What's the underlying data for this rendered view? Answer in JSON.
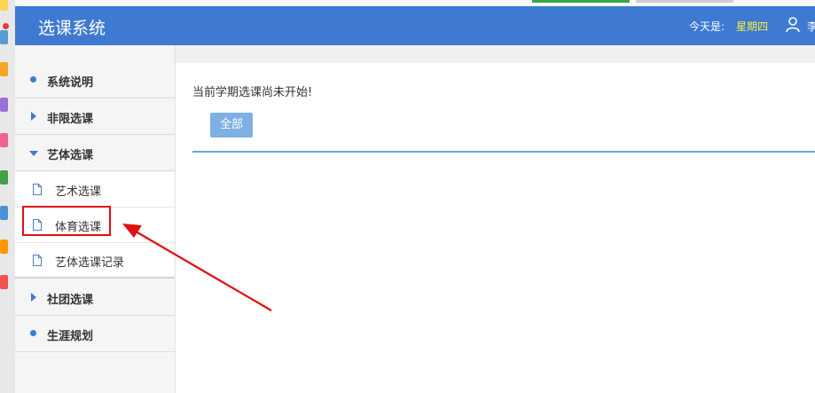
{
  "header": {
    "title": "选课系统",
    "today_label": "今天是:",
    "weekday": "星期四",
    "user_name": "李"
  },
  "sidebar": {
    "items": [
      {
        "label": "系统说明",
        "marker": "bullet"
      },
      {
        "label": "非限选课",
        "marker": "arrow-right"
      },
      {
        "label": "艺体选课",
        "marker": "arrow-down",
        "expanded": true
      },
      {
        "label": "社团选课",
        "marker": "arrow-right"
      },
      {
        "label": "生涯规划",
        "marker": "bullet"
      }
    ],
    "sub_items": [
      {
        "label": "艺术选课",
        "icon": "document-icon"
      },
      {
        "label": "体育选课",
        "icon": "document-icon",
        "highlighted": true
      },
      {
        "label": "艺体选课记录",
        "icon": "document-icon"
      }
    ]
  },
  "main": {
    "notice": "当前学期选课尚未开始!",
    "filter_button": "全部"
  },
  "colors": {
    "header_bg": "#3e7ad2",
    "weekday_text": "#ffec3d",
    "button_bg": "#7eb0e4",
    "highlight_box": "#e01010",
    "annotation_arrow": "#e01010"
  }
}
